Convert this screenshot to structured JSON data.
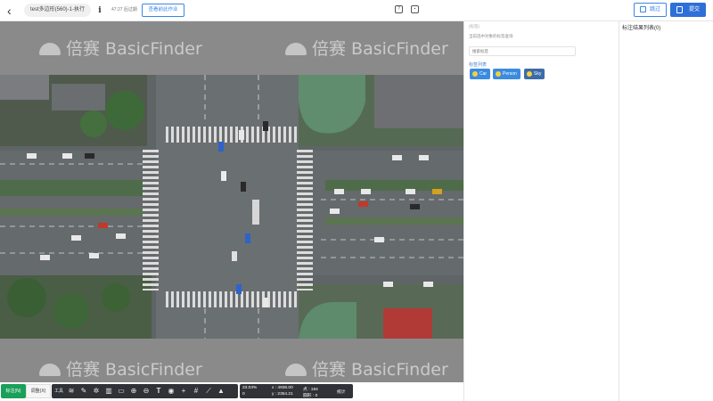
{
  "header": {
    "back_icon": "chevron-left-icon",
    "task_name": "test多边形(560)-1-执行",
    "time_left": "47:27 后过期",
    "view_button": "查看前此作业",
    "skip_label": "跳过",
    "submit_label": "提交"
  },
  "watermark": {
    "brand": "倍赛 BasicFinder"
  },
  "label_panel": {
    "hint": "(标签)",
    "sub": "当前选中对象的标签查询",
    "search_placeholder": "搜索标签",
    "list_title": "标签列表",
    "tags": [
      "Car",
      "Person",
      "Sky"
    ]
  },
  "result_panel": {
    "title": "标注结果列表(0)"
  },
  "toolbar": {
    "mark_all": "标注(N)",
    "adjust": "调整(X)",
    "tool_label": "工具",
    "stats": {
      "zoom": "23.03%",
      "zero": "0",
      "x": "x : 4936.00",
      "y": "y : 2354.21",
      "points_label": "点 : 184",
      "circles_label": "圆形 : 0",
      "total_label": "统计"
    }
  },
  "colors": {
    "accent": "#2e6fd8",
    "tag": "#3b8be0",
    "green": "#1aa05a",
    "canvas_bg": "#8a8a8a",
    "toolbar_dark": "#2f3338"
  }
}
